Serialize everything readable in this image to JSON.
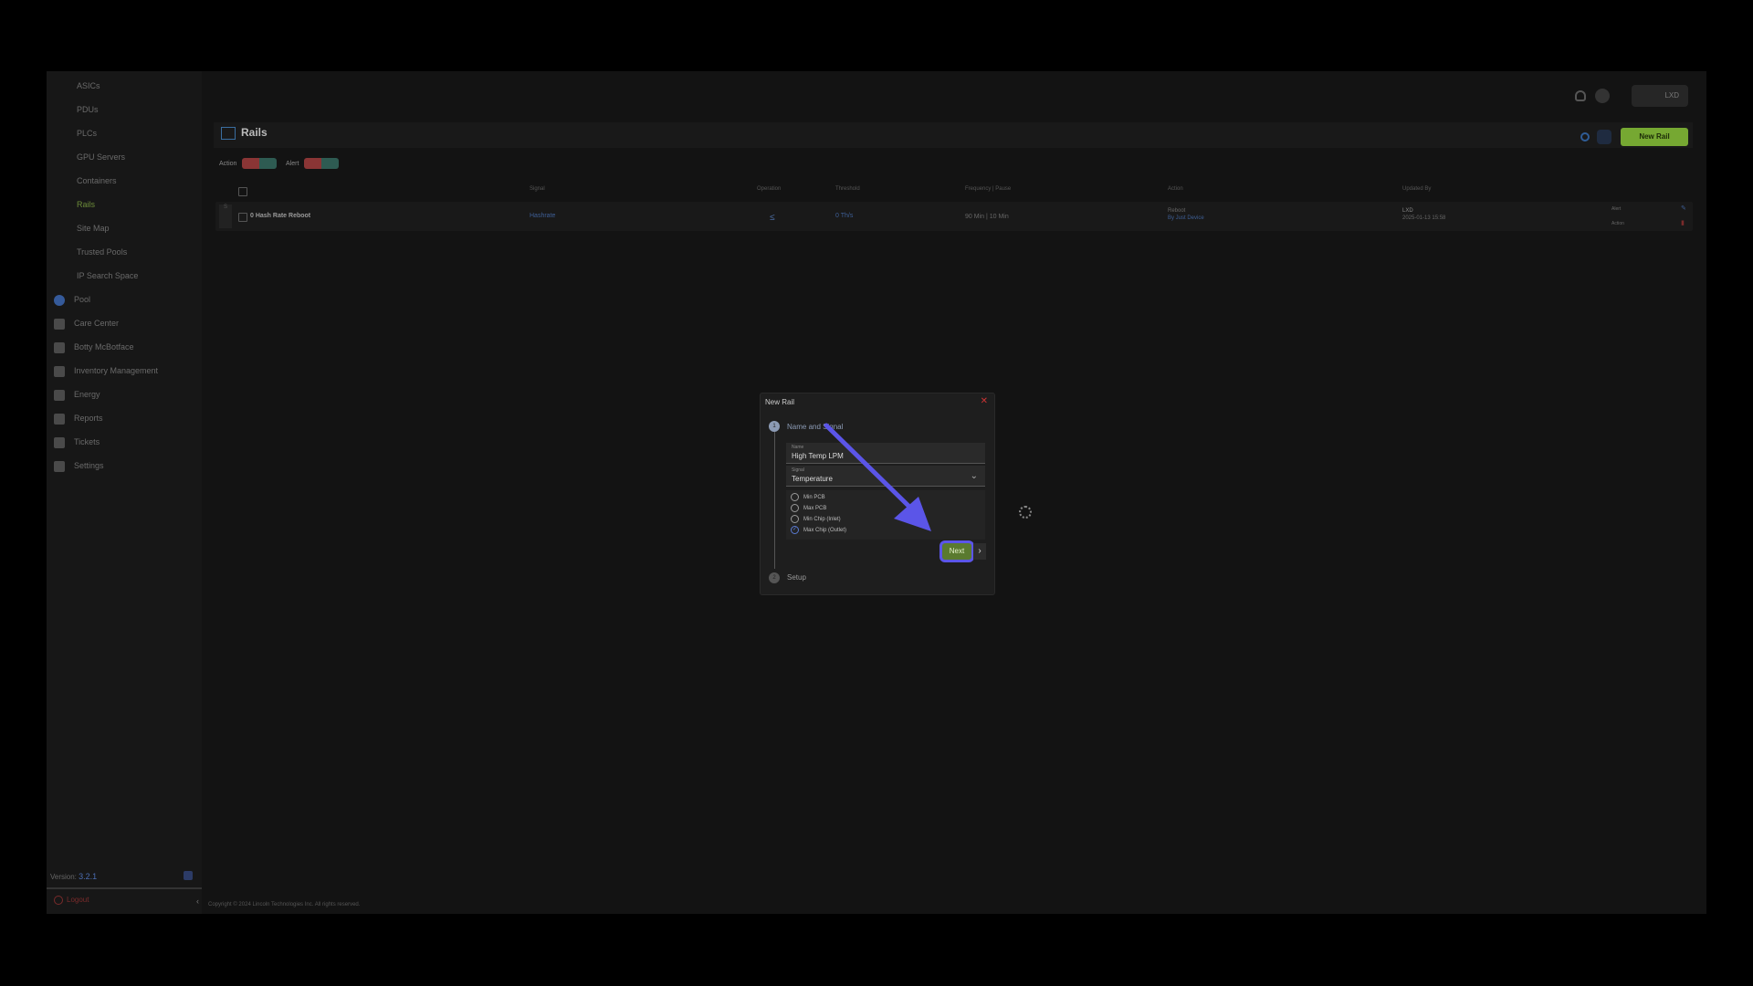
{
  "sidebar": {
    "sub_items": [
      "ASICs",
      "PDUs",
      "PLCs",
      "GPU Servers",
      "Containers",
      "Rails",
      "Site Map",
      "Trusted Pools",
      "IP Search Space"
    ],
    "active": "Rails",
    "main_items": [
      "Pool",
      "Care Center",
      "Botty McBotface",
      "Inventory Management",
      "Energy",
      "Reports",
      "Tickets",
      "Settings"
    ],
    "version_label": "Version:",
    "version_value": "3.2.1",
    "logout": "Logout"
  },
  "header": {
    "user": "LXD"
  },
  "panel": {
    "title": "Rails",
    "action_label": "Action",
    "alert_label": "Alert",
    "new_rail_button": "New Rail"
  },
  "table": {
    "columns": [
      "Signal",
      "Operation",
      "Threshold",
      "Frequency | Pause",
      "Action",
      "Updated By"
    ],
    "row": {
      "handle": "S",
      "name": "0 Hash Rate Reboot",
      "signal": "Hashrate",
      "operation": "≤",
      "threshold": "0 Th/s",
      "frequency": "90 Min | 10 Min",
      "action": "Reboot",
      "action_by": "By Just Device",
      "updated_by": "LXD",
      "updated_at": "2025-01-13 15:58",
      "alert_toggle": "Alert",
      "action_toggle": "Action"
    }
  },
  "footer": "Copyright © 2024 Lincoln Technologies Inc. All rights reserved.",
  "modal": {
    "title": "New Rail",
    "close": "✕",
    "step1_num": "1",
    "step1_label": "Name and Signal",
    "name_label": "Name",
    "name_value": "High Temp LPM",
    "signal_label": "Signal",
    "signal_value": "Temperature",
    "options": [
      "Min PCB",
      "Max PCB",
      "Min Chip (Inlet)",
      "Max Chip (Outlet)"
    ],
    "selected_option": "Max Chip (Outlet)",
    "next_button": "Next",
    "next_arrow": "›",
    "step2_num": "2",
    "step2_label": "Setup"
  },
  "annotation_color": "#5b55e8"
}
